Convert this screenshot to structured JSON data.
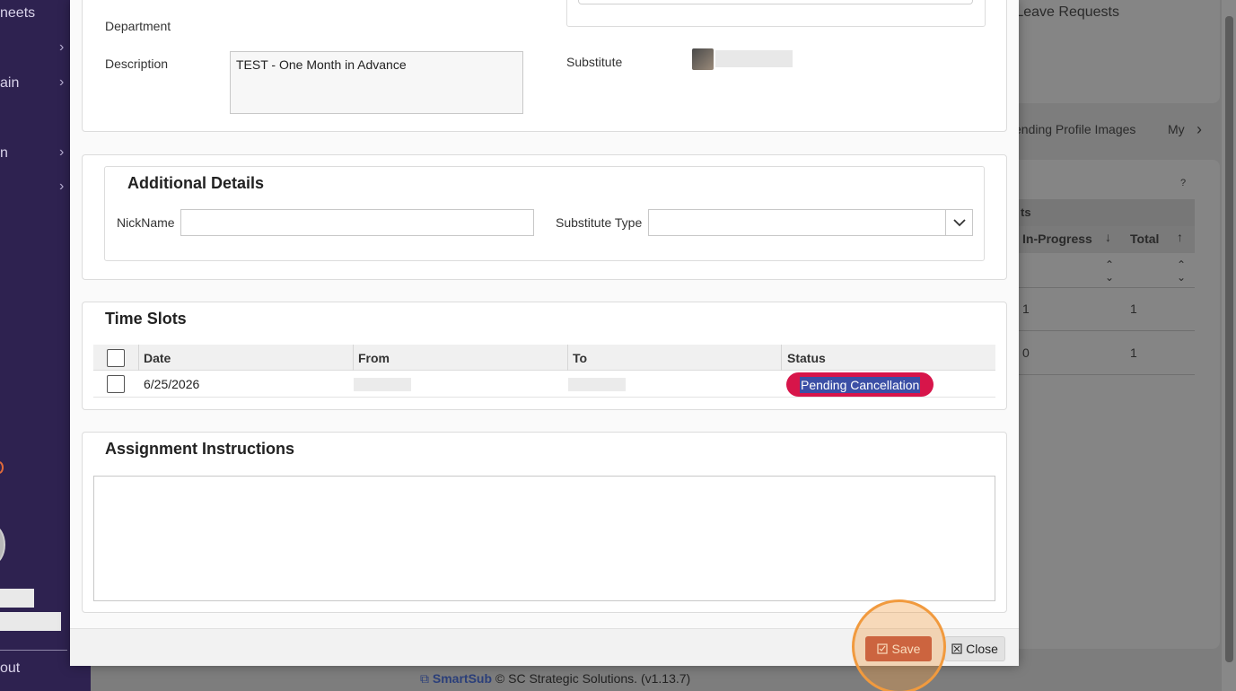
{
  "sidebar": {
    "items": [
      {
        "label": "neets"
      },
      {
        "label": "ain"
      },
      {
        "label": "n"
      },
      {
        "label": "out"
      }
    ]
  },
  "background": {
    "card_title": "g Leave Requests",
    "tabs": [
      "ending Profile Images",
      "My"
    ],
    "help_mark": "?",
    "table_group": "ts",
    "table_headers": [
      "In-Progress",
      "Total"
    ],
    "rows": [
      {
        "in_progress": "1",
        "total": "1"
      },
      {
        "in_progress": "0",
        "total": "1"
      }
    ]
  },
  "footer": {
    "brand": "SmartSub",
    "copyright": "© SC Strategic Solutions. (v1.13.7)"
  },
  "modal": {
    "details": {
      "department_label": "Department",
      "description_label": "Description",
      "description_value": "TEST - One Month in Advance",
      "substitute_label": "Substitute"
    },
    "additional_details": {
      "heading": "Additional Details",
      "nickname_label": "NickName",
      "nickname_value": "",
      "substitute_type_label": "Substitute Type",
      "substitute_type_value": ""
    },
    "time_slots": {
      "heading": "Time Slots",
      "columns": [
        "Date",
        "From",
        "To",
        "Status"
      ],
      "rows": [
        {
          "date": "6/25/2026",
          "from": "",
          "to": "",
          "status": "Pending Cancellation"
        }
      ]
    },
    "assignment_instructions": {
      "heading": "Assignment Instructions",
      "value": ""
    },
    "buttons": {
      "save": "Save",
      "close": "Close"
    }
  },
  "colors": {
    "sidebar_bg": "#2e2250",
    "status_pill": "#d7154a",
    "save_button": "#b8473f",
    "highlight_ring": "#f19a3e"
  },
  "icons": [
    "chevron-right-icon",
    "chevron-down-icon",
    "sort-down-icon",
    "sort-up-icon",
    "checkbox-icon",
    "close-icon",
    "save-icon"
  ]
}
